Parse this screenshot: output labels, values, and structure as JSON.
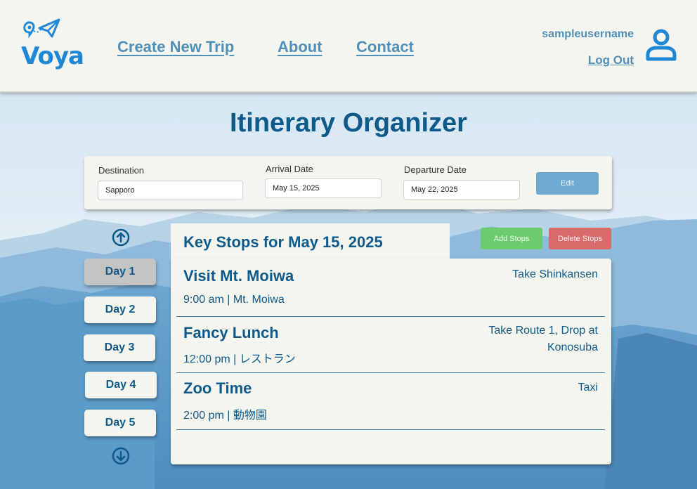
{
  "brand": {
    "name": "Voya"
  },
  "nav": {
    "create_trip": "Create New Trip",
    "about": "About",
    "contact": "Contact"
  },
  "user": {
    "username": "sampleusername",
    "logout": "Log Out"
  },
  "page": {
    "title": "Itinerary Organizer"
  },
  "trip": {
    "destination_label": "Destination",
    "destination_value": "Sapporo",
    "arrival_label": "Arrival Date",
    "arrival_value": "May 15, 2025",
    "departure_label": "Departure Date",
    "departure_value": "May 22, 2025",
    "edit_label": "Edit"
  },
  "days": [
    "Day 1",
    "Day 2",
    "Day 3",
    "Day 4",
    "Day 5"
  ],
  "active_day": "Day 1",
  "stops_header": "Key Stops for May 15, 2025",
  "actions": {
    "add": "Add Stops",
    "delete": "Delete Stops"
  },
  "stops": [
    {
      "title": "Visit Mt. Moiwa",
      "meta": "9:00 am | Mt. Moiwa",
      "transport_line1": "Take Shinkansen",
      "transport_line2": ""
    },
    {
      "title": "Fancy Lunch",
      "meta": "12:00 pm | レストラン",
      "transport_line1": "Take Route 1, Drop at",
      "transport_line2": "Konosuba"
    },
    {
      "title": "Zoo Time",
      "meta": "2:00 pm | 動物園",
      "transport_line1": "Taxi",
      "transport_line2": ""
    }
  ],
  "colors": {
    "accent": "#0e5a8a",
    "link": "#4f8fb8",
    "brand": "#1e88d6",
    "edit_button": "#6ea9d1",
    "add_button": "#6ccb6c",
    "delete_button": "#d96a6a",
    "panel": "#f5f5ef"
  },
  "icons": {
    "logo": "paper-plane-location-icon",
    "user": "user-icon",
    "scroll_up": "arrow-up-circle-icon",
    "scroll_down": "arrow-down-circle-icon"
  }
}
